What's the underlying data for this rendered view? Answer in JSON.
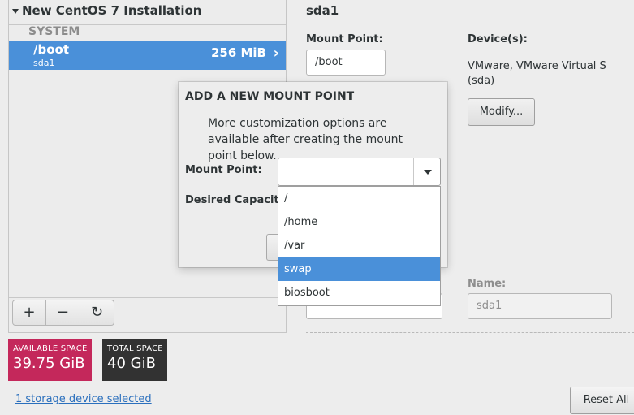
{
  "tree": {
    "header": "New CentOS 7 Installation",
    "group_label": "SYSTEM",
    "selected_item": {
      "mount_point": "/boot",
      "device": "sda1",
      "size": "256 MiB"
    }
  },
  "pane_buttons": [
    "+",
    "−",
    "↻"
  ],
  "space": {
    "available_label": "AVAILABLE SPACE",
    "available_value": "39.75 GiB",
    "total_label": "TOTAL SPACE",
    "total_value": "40 GiB"
  },
  "storage_link": "1 storage device selected",
  "details": {
    "title": "sda1",
    "mount_point_label": "Mount Point:",
    "mount_point_value": "/boot",
    "devices_label": "Device(s):",
    "device_line1": "VMware, VMware Virtual S",
    "device_line2": "(sda)",
    "modify_button": "Modify...",
    "name_label": "Name:",
    "name_value": "sda1"
  },
  "reset_button": "Reset All",
  "modal": {
    "title": "ADD A NEW MOUNT POINT",
    "description": "More customization options are available after creating the mount point below.",
    "mount_point_label": "Mount Point:",
    "capacity_label": "Desired Capacity:",
    "combo_value": "",
    "options": [
      "/",
      "/home",
      "/var",
      "swap",
      "biosboot"
    ],
    "highlighted_option": "swap"
  },
  "colors": {
    "accent": "#4a90d9",
    "available_space": "#c4285b",
    "total_space": "#323232"
  }
}
